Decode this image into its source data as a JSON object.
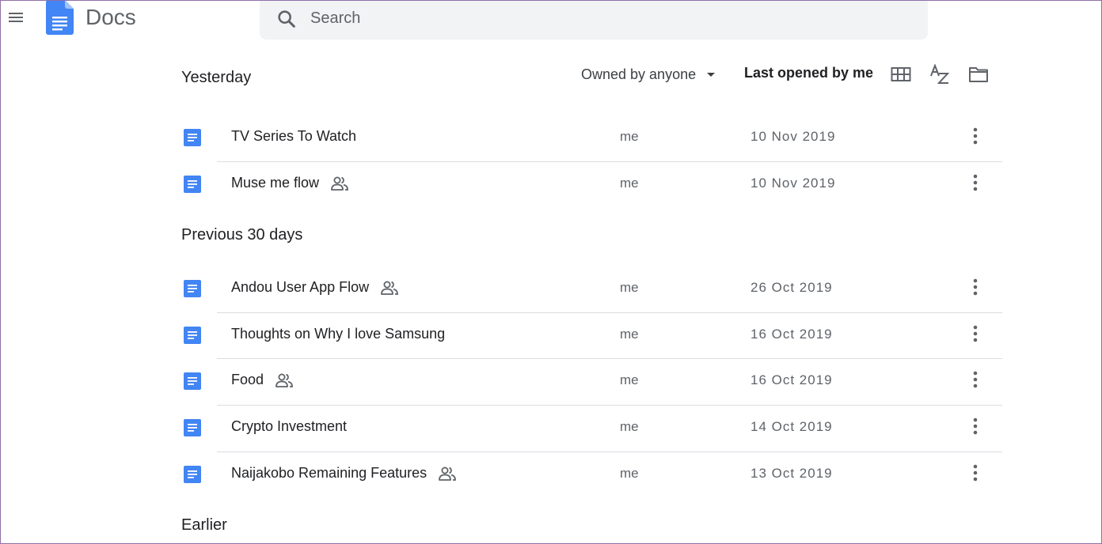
{
  "header": {
    "app_title": "Docs",
    "menu_icon": "hamburger-menu-icon",
    "logo_icon": "google-docs-logo-icon",
    "search_placeholder": "Search",
    "search_value": ""
  },
  "toolbar": {
    "owner_filter": "Owned by anyone",
    "sort_label": "Last opened by me",
    "icons": [
      "grid-view-icon",
      "sort-az-icon",
      "folder-icon"
    ]
  },
  "colors": {
    "doc_blue": "#4285f4",
    "text_primary": "#202124",
    "text_secondary": "#5f6368",
    "search_bg": "#f1f3f4",
    "divider": "#dadce0"
  },
  "sections": [
    {
      "title": "Yesterday",
      "docs": [
        {
          "name": "TV Series To Watch",
          "shared": false,
          "owner": "me",
          "date": "10 Nov 2019"
        },
        {
          "name": "Muse me flow",
          "shared": true,
          "owner": "me",
          "date": "10 Nov 2019"
        }
      ]
    },
    {
      "title": "Previous 30 days",
      "docs": [
        {
          "name": "Andou User App Flow",
          "shared": true,
          "owner": "me",
          "date": "26 Oct 2019"
        },
        {
          "name": "Thoughts on Why I love Samsung",
          "shared": false,
          "owner": "me",
          "date": "16 Oct 2019"
        },
        {
          "name": "Food",
          "shared": true,
          "owner": "me",
          "date": "16 Oct 2019"
        },
        {
          "name": "Crypto Investment",
          "shared": false,
          "owner": "me",
          "date": "14 Oct 2019"
        },
        {
          "name": "Naijakobo Remaining Features",
          "shared": true,
          "owner": "me",
          "date": "13 Oct 2019"
        }
      ]
    },
    {
      "title": "Earlier",
      "docs": []
    }
  ]
}
